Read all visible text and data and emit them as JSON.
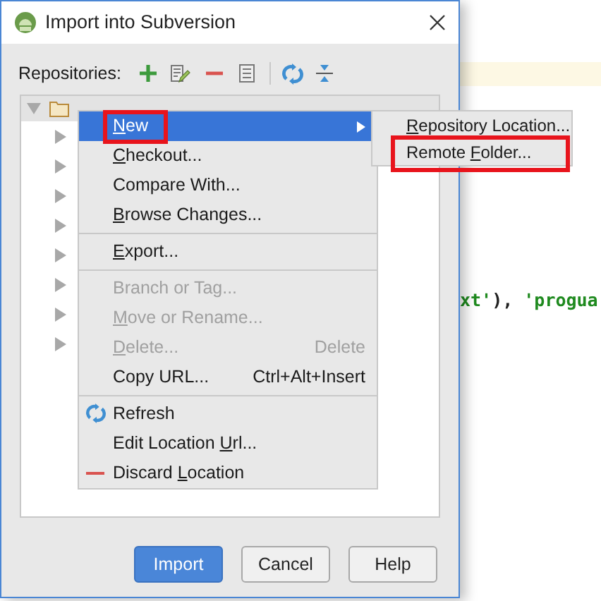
{
  "window": {
    "title": "Import into Subversion"
  },
  "toolbar": {
    "label": "Repositories:"
  },
  "tree": {
    "expanded": true,
    "children": [
      {
        "expanded": false
      },
      {
        "expanded": false
      },
      {
        "expanded": false
      },
      {
        "expanded": false
      },
      {
        "expanded": false
      },
      {
        "expanded": false
      },
      {
        "expanded": false
      },
      {
        "expanded": false
      }
    ]
  },
  "context_menu": [
    {
      "kind": "item",
      "mnemonic": "N",
      "after": "ew",
      "selected": true,
      "submenu": true,
      "annotated": true,
      "disabled": false
    },
    {
      "kind": "item",
      "mnemonic": "C",
      "after": "heckout...",
      "selected": false,
      "submenu": false,
      "annotated": false,
      "disabled": false
    },
    {
      "kind": "item",
      "before": "Compare With...",
      "selected": false,
      "submenu": false,
      "annotated": false,
      "disabled": false
    },
    {
      "kind": "item",
      "mnemonic": "B",
      "after": "rowse Changes...",
      "selected": false,
      "submenu": false,
      "annotated": false,
      "disabled": false
    },
    {
      "kind": "separator"
    },
    {
      "kind": "item",
      "mnemonic": "E",
      "after": "xport...",
      "selected": false,
      "submenu": false,
      "annotated": false,
      "disabled": false
    },
    {
      "kind": "separator"
    },
    {
      "kind": "item",
      "before": "Branch or Tag...",
      "selected": false,
      "submenu": false,
      "annotated": false,
      "disabled": true
    },
    {
      "kind": "item",
      "mnemonic": "M",
      "after": "ove or Rename...",
      "selected": false,
      "submenu": false,
      "annotated": false,
      "disabled": true
    },
    {
      "kind": "item",
      "mnemonic": "D",
      "after": "elete...",
      "shortcut": "Delete",
      "selected": false,
      "submenu": false,
      "annotated": false,
      "disabled": true
    },
    {
      "kind": "item",
      "before": "Copy URL...",
      "shortcut": "Ctrl+Alt+Insert",
      "selected": false,
      "submenu": false,
      "annotated": false,
      "disabled": false
    },
    {
      "kind": "separator"
    },
    {
      "kind": "refresh",
      "before": "Refresh",
      "selected": false,
      "submenu": false,
      "annotated": false,
      "disabled": false
    },
    {
      "kind": "item",
      "before": "Edit Location ",
      "mnemonic": "U",
      "after": "rl...",
      "selected": false,
      "submenu": false,
      "annotated": false,
      "disabled": false
    },
    {
      "kind": "discard",
      "before": "Discard ",
      "mnemonic": "L",
      "after": "ocation",
      "selected": false,
      "submenu": false,
      "annotated": false,
      "disabled": false
    }
  ],
  "submenu": [
    {
      "mnemonic": "R",
      "after": "epository Location...",
      "annotated": false
    },
    {
      "before": "Remote ",
      "mnemonic": "F",
      "after": "older...",
      "annotated": true
    }
  ],
  "buttons": [
    {
      "label": "Import",
      "primary": true
    },
    {
      "label": "Cancel",
      "primary": false
    },
    {
      "label": "Help",
      "primary": false
    }
  ],
  "editor_code": [
    {
      "kind": "string",
      "text": "xt'"
    },
    {
      "kind": "plain",
      "text": "), "
    },
    {
      "kind": "string",
      "text": "'progua"
    }
  ]
}
